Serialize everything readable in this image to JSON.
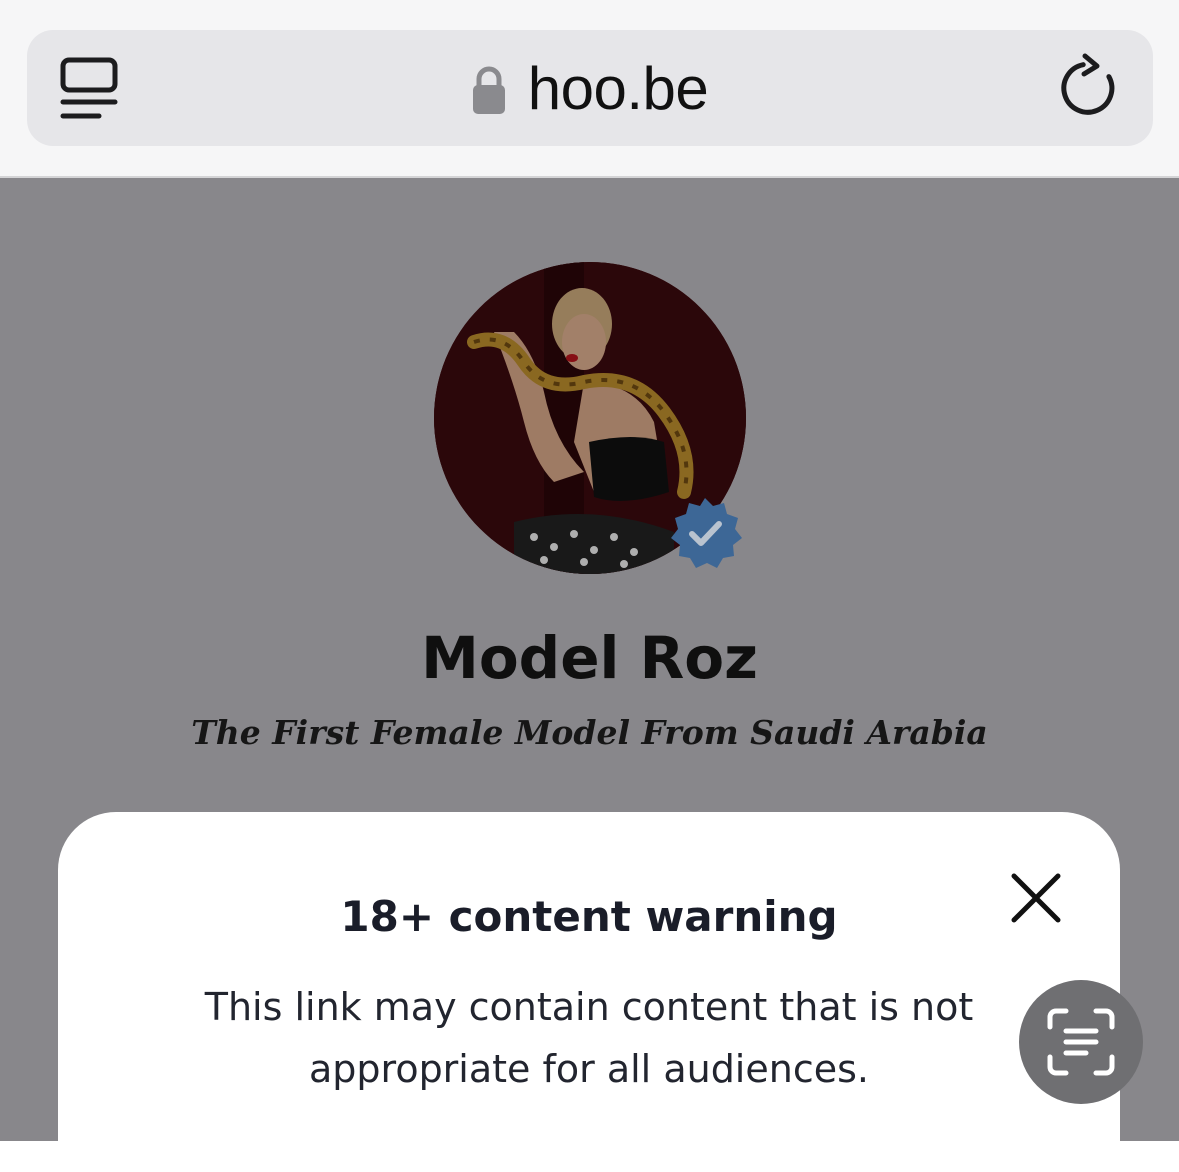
{
  "browser": {
    "url": "hoo.be",
    "icons": {
      "tabs": "tabs-icon",
      "lock": "lock-icon",
      "reload": "reload-icon"
    }
  },
  "profile": {
    "name": "Model Roz",
    "tagline": "The First Female Model From Saudi Arabia",
    "verified": true
  },
  "modal": {
    "title": "18+ content warning",
    "body_line1": "This link may contain content that is not",
    "body_line2": "appropriate for all audiences."
  },
  "colors": {
    "overlay": "#88878b",
    "verified_badge": "#3d6796",
    "fab": "#6f6f72"
  }
}
